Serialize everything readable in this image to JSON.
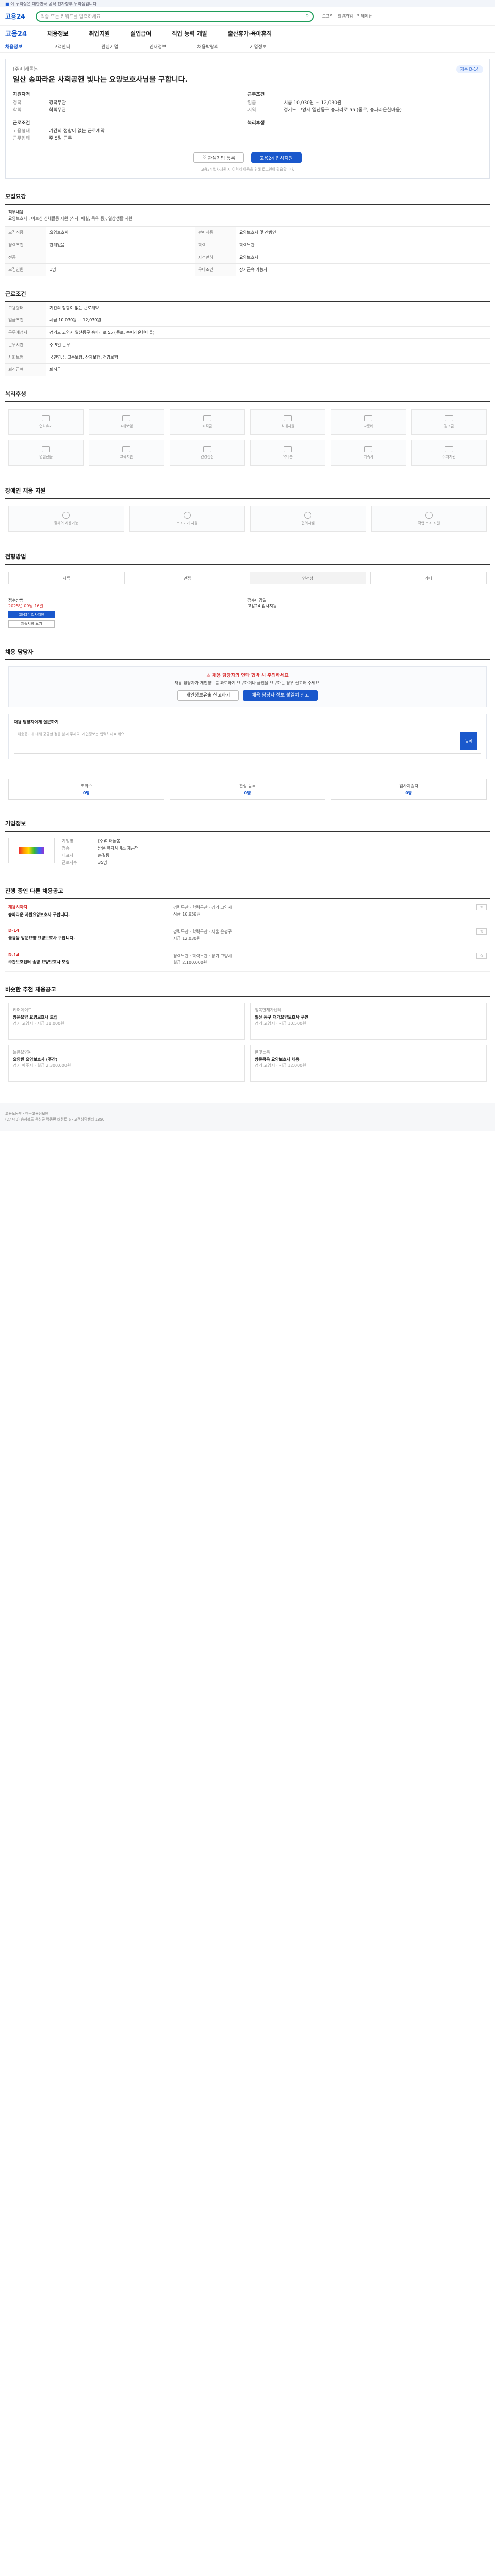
{
  "gov_bar": {
    "text": "이 누리집은 대한민국 공식 전자정부 누리집입니다."
  },
  "header": {
    "logo": "고용24",
    "search_placeholder": "직종 또는 키워드를 입력하세요",
    "links": [
      "로그인",
      "회원가입",
      "전체메뉴"
    ]
  },
  "gnb": {
    "brand": "고용24",
    "items": [
      "채용정보",
      "취업지원",
      "실업급여",
      "직업 능력 개발",
      "출산휴가·육아휴직"
    ]
  },
  "subtabs": [
    "채용정보",
    "고객센터",
    "관심기업",
    "인재정보",
    "채용박람회",
    "기업정보"
  ],
  "title": {
    "company": "(주)미래돌봄",
    "badge": "채용 D-14",
    "heading": "일산 송파라운 사회공헌 빛나는 요양보호사님을 구합니다."
  },
  "summary": {
    "left_group": "지원자격",
    "left": [
      {
        "k": "경력",
        "v": "경력무관"
      },
      {
        "k": "학력",
        "v": "학력무관"
      }
    ],
    "left_group2": "근로조건",
    "left2": [
      {
        "k": "고용형태",
        "v": "기간의 정함이 없는 근로계약"
      },
      {
        "k": "근무형태",
        "v": "주 5일 근무"
      }
    ],
    "right_group": "근무조건",
    "right": [
      {
        "k": "임금",
        "v": "시급 10,030원 ~ 12,030원"
      },
      {
        "k": "지역",
        "v": "경기도 고양시 일산동구 송파라로 55 (종로, 송파라운한마을)"
      }
    ],
    "right_group2": "복리후생",
    "right2": [
      {
        "k": "",
        "v": ""
      }
    ]
  },
  "actions": {
    "interest": "관심기업 등록",
    "apply": "고용24 입사지원"
  },
  "note": "고용24 입사지원 시 이력서 이용을 위해 로그인이 필요합니다.",
  "sections": {
    "recruit": {
      "title": "모집요강",
      "job_title_label": "직무내용",
      "job_desc": "요양보호사 : 어르신 신체활동 지원 (식사, 배설, 목욕 등), 일상생활 지원",
      "rows": [
        {
          "k": "모집직종",
          "v": "요양보호사"
        },
        {
          "k": "관련직종",
          "v": "요양보호사 및 간병인"
        },
        {
          "k": "경력조건",
          "v": "관계없음"
        },
        {
          "k": "학력",
          "v": "학력무관"
        },
        {
          "k": "전공",
          "v": ""
        },
        {
          "k": "자격면허",
          "v": "요양보호사"
        },
        {
          "k": "모집인원",
          "v": "1명"
        },
        {
          "k": "우대조건",
          "v": "장기근속 가능자"
        }
      ]
    },
    "conditions": {
      "title": "근로조건",
      "rows": [
        {
          "k": "고용형태",
          "v": "기간의 정함이 없는 근로계약"
        },
        {
          "k": "임금조건",
          "v": "시급 10,030원 ~ 12,030원"
        },
        {
          "k": "근무예정지",
          "v": "경기도 고양시 일산동구 송파라로 55 (종로, 송파라운한마을)"
        },
        {
          "k": "근무시간",
          "v": "주 5일 근무"
        },
        {
          "k": "사회보험",
          "v": "국민연금, 고용보험, 산재보험, 건강보험"
        },
        {
          "k": "퇴직급여",
          "v": "퇴직금"
        }
      ]
    },
    "welfare": {
      "title": "복리후생"
    },
    "apply": {
      "title": "전형방법"
    },
    "report": {
      "title": "채용 담당자"
    },
    "company": {
      "title": "기업정보"
    },
    "other_jobs": {
      "title": "진행 중인 다른 채용공고"
    },
    "recommended": {
      "title": "비슷한 추천 채용공고"
    }
  },
  "welfare_icons": [
    "연차휴가",
    "4대보험",
    "퇴직금",
    "식대지원",
    "교통비",
    "경조금",
    "명절선물",
    "교육지원",
    "건강검진",
    "유니폼",
    "기숙사",
    "주차지원"
  ],
  "barrier_free_title": "장애인 채용 지원",
  "barrier_free": [
    "휠체어 사용가능",
    "보조기기 지원",
    "편의시설",
    "작업 보조 지원"
  ],
  "steps": [
    "서류",
    "면접",
    "인적성",
    "기타"
  ],
  "apply_info": {
    "method_label": "접수방법",
    "method": "고용24 입사지원",
    "deadline_label": "접수마감일",
    "deadline": "2025년 09월 16일",
    "apply_btn": "고용24 입사지원",
    "doc_btn": "제출서류 보기"
  },
  "warning": {
    "title": "채용 담당자의 연락 협박 시 주의하세요",
    "text": "채용 담당자가 개인정보를 과도하게 요구하거나 금전을 요구하는 경우 신고해 주세요.",
    "btn1": "개인정보유출 신고하기",
    "btn2": "채용 담당자 정보 불일치 신고"
  },
  "report_box": {
    "label": "채용 담당자에게 질문하기",
    "placeholder": "채용공고에 대해 궁금한 점을 남겨 주세요. 개인정보는 입력하지 마세요.",
    "send": "등록"
  },
  "stats": [
    {
      "label": "조회수",
      "value": "0명"
    },
    {
      "label": "관심 등록",
      "value": "0명"
    },
    {
      "label": "입사지원자",
      "value": "0명"
    }
  ],
  "company_info": {
    "name": "(주)미래돌봄",
    "rows": [
      {
        "k": "기업명",
        "v": "(주)미래돌봄"
      },
      {
        "k": "업종",
        "v": "방문 복지서비스 제공업"
      },
      {
        "k": "대표자",
        "v": "홍길동"
      },
      {
        "k": "근로자수",
        "v": "35명"
      }
    ]
  },
  "other_jobs": [
    {
      "dday": "채용시까지",
      "title": "송파라운 자원요양보호사 구합니다.",
      "meta": "경력무관 · 학력무관 · 경기 고양시",
      "pay": "시급 10,030원"
    },
    {
      "dday": "D-14",
      "title": "불광동 방문요양 요양보호사 구합니다.",
      "meta": "경력무관 · 학력무관 · 서울 은평구",
      "pay": "시급 12,030원"
    },
    {
      "dday": "D-14",
      "title": "주간보호센터 송영 요양보호사 모집",
      "meta": "경력무관 · 학력무관 · 경기 고양시",
      "pay": "월급 2,100,000원"
    }
  ],
  "recommended": [
    {
      "co": "케어메이트",
      "title": "방문요양 요양보호사 모집",
      "meta": "경기 고양시 · 시급 11,000원"
    },
    {
      "co": "행복한재가센터",
      "title": "일산 동구 재가요양보호사 구인",
      "meta": "경기 고양시 · 시급 10,500원"
    },
    {
      "co": "늘봄요양원",
      "title": "요양원 요양보호사 (주간)",
      "meta": "경기 파주시 · 월급 2,300,000원"
    },
    {
      "co": "한빛돌봄",
      "title": "방문목욕 요양보호사 채용",
      "meta": "경기 고양시 · 시급 12,000원"
    }
  ],
  "footer": {
    "line1": "고용노동부 · 한국고용정보원",
    "line2": "(27740) 충청북도 음성군 맹동면 태정로 6 · 고객상담센터 1350"
  }
}
